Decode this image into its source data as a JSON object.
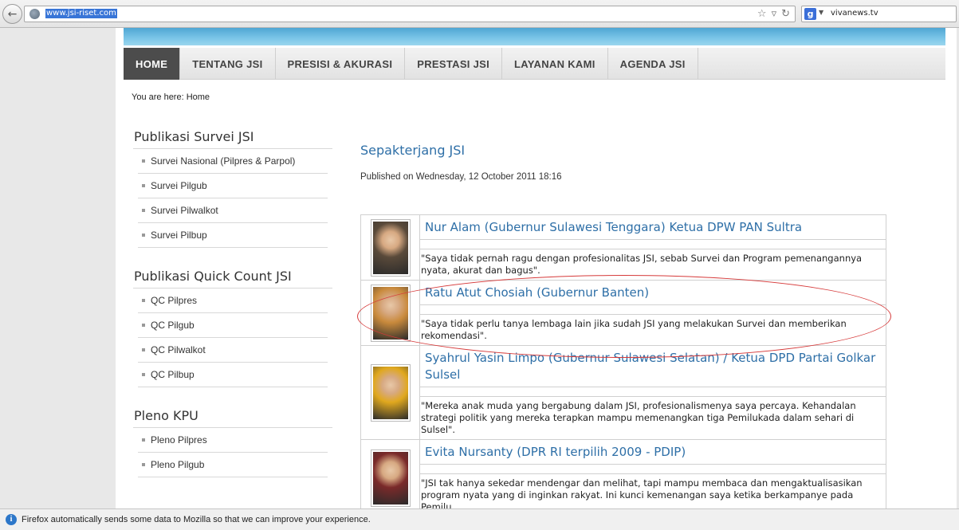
{
  "browser": {
    "url": "www.jsi-riset.com",
    "search_text": "vivanews.tv",
    "search_engine_letter": "g",
    "back_icon": "back-arrow-icon"
  },
  "nav": {
    "items": [
      "HOME",
      "TENTANG JSI",
      "PRESISI & AKURASI",
      "PRESTASI JSI",
      "LAYANAN KAMI",
      "AGENDA JSI"
    ],
    "active": "HOME"
  },
  "breadcrumb": "You are here:  Home",
  "sidebar": {
    "sections": [
      {
        "title": "Publikasi Survei JSI",
        "items": [
          "Survei Nasional (Pilpres & Parpol)",
          "Survei Pilgub",
          "Survei Pilwalkot",
          "Survei Pilbup"
        ]
      },
      {
        "title": "Publikasi Quick Count JSI",
        "items": [
          "QC Pilpres",
          "QC Pilgub",
          "QC Pilwalkot",
          "QC Pilbup"
        ]
      },
      {
        "title": "Pleno KPU",
        "items": [
          "Pleno Pilpres",
          "Pleno Pilgub"
        ]
      }
    ]
  },
  "article": {
    "title": "Sepakterjang JSI",
    "published": "Published on Wednesday, 12 October 2011 18:16",
    "quotes": [
      {
        "name": "Nur Alam (Gubernur Sulawesi Tenggara) Ketua DPW PAN Sultra",
        "text": "\"Saya tidak pernah ragu dengan profesionalitas JSI, sebab Survei dan Program pemenangannya nyata, akurat dan bagus\".",
        "photo_color": "#5a4a3a"
      },
      {
        "name": "Ratu Atut Chosiah (Gubernur Banten)",
        "text": "\"Saya tidak perlu tanya lembaga lain jika sudah JSI yang melakukan Survei dan memberikan rekomendasi\".",
        "photo_color": "#c98a3c"
      },
      {
        "name": "Syahrul Yasin Limpo (Gubernur Sulawesi Selatan) / Ketua DPD Partai Golkar Sulsel",
        "text": "\"Mereka anak muda yang bergabung dalam JSI, profesionalismenya saya percaya. Kehandalan strategi politik yang mereka terapkan mampu memenangkan tiga Pemilukada dalam sehari di Sulsel\".",
        "photo_color": "#e0a81e"
      },
      {
        "name": "Evita Nursanty (DPR RI terpilih 2009 - PDIP)",
        "text": "\"JSI tak hanya sekedar mendengar dan melihat, tapi mampu membaca dan mengaktualisasikan program nyata yang di inginkan rakyat. Ini kunci kemenangan saya ketika berkampanye pada Pemilu",
        "photo_color": "#7a2a2a"
      }
    ]
  },
  "notification": "Firefox automatically sends some data to Mozilla so that we can improve your experience."
}
